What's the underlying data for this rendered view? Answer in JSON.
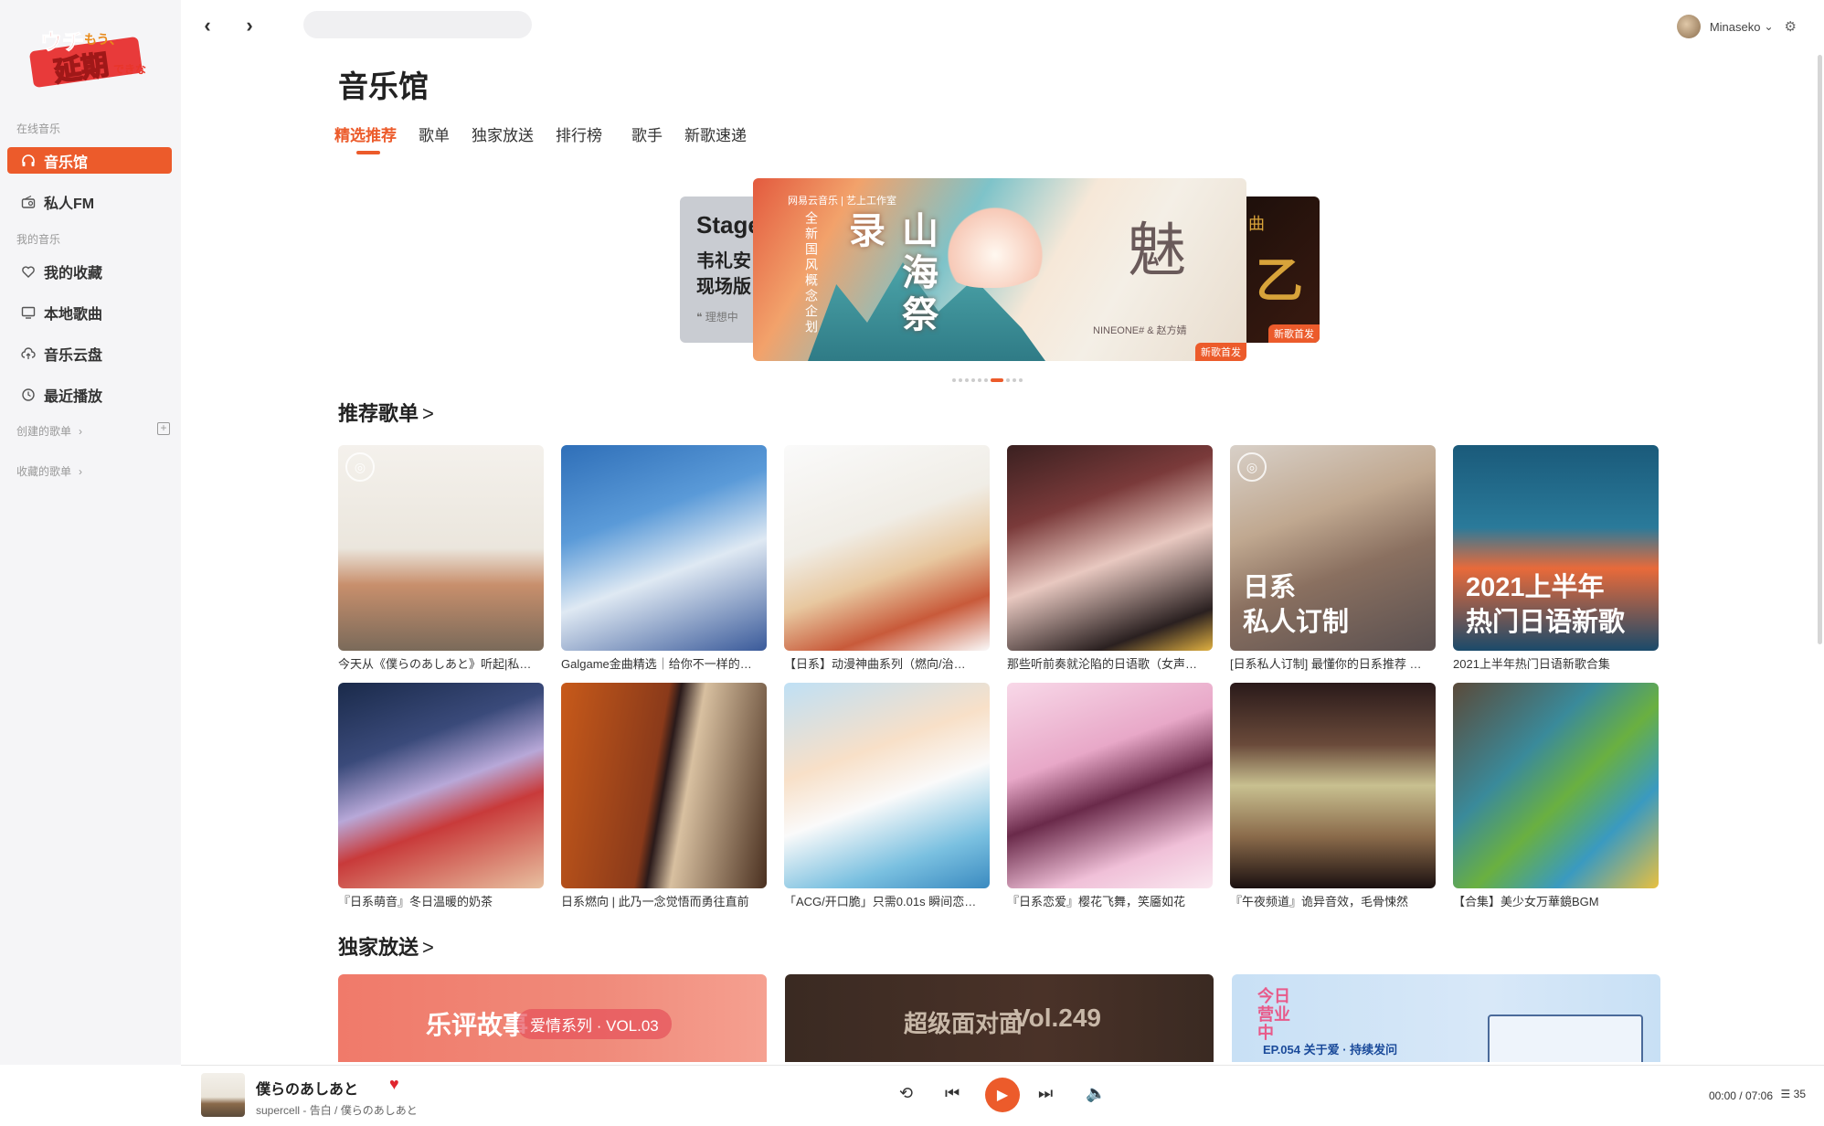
{
  "logo_text": "ウチはもう、延期できない。",
  "sidebar": {
    "online_label": "在线音乐",
    "items_online": [
      {
        "label": "音乐馆",
        "icon": "headphones-icon",
        "glyph": "🎧"
      },
      {
        "label": "私人FM",
        "icon": "radio-icon",
        "glyph": "📻"
      }
    ],
    "my_music_label": "我的音乐",
    "items_mine": [
      {
        "label": "我的收藏",
        "icon": "heart-icon",
        "glyph": "♡"
      },
      {
        "label": "本地歌曲",
        "icon": "monitor-icon",
        "glyph": "🖥"
      },
      {
        "label": "音乐云盘",
        "icon": "cloud-icon",
        "glyph": "☁"
      },
      {
        "label": "最近播放",
        "icon": "clock-icon",
        "glyph": "🕒"
      }
    ],
    "created_label": "创建的歌单",
    "collected_label": "收藏的歌单"
  },
  "topbar": {
    "back": "‹",
    "forward": "›",
    "search_placeholder": "",
    "username": "Minaseko",
    "caret": "⌄",
    "gear": "⚙"
  },
  "page_title": "音乐馆",
  "tabs": [
    "精选推荐",
    "歌单",
    "独家放送",
    "排行榜",
    "歌手",
    "新歌速递"
  ],
  "banner": {
    "left": {
      "title": "Stage",
      "line1": "韦礼安",
      "line2": "现场版",
      "quote": "❝ 理想中"
    },
    "main": {
      "header": "网易云音乐 | 艺上工作室",
      "vertical": "全新国风概念企划",
      "big": "山海祭录",
      "glyph": "魅",
      "credit": "NINEONE# & 赵方婧",
      "badge": "新歌首发"
    },
    "right": {
      "glyph": "曲",
      "glyph2": "乙",
      "badge": "新歌首发"
    },
    "dots_count": 10,
    "active_dot": 7
  },
  "recommend": {
    "title": "推荐歌单",
    "chevron": ">",
    "playlists": [
      {
        "title": "今天从《僕らのあしあと》听起|私…",
        "overlay": "",
        "radio": true,
        "bg": "linear-gradient(180deg,#f4f1ec 0%,#ebe6dd 50%,#c88f6c 68%,#7a6a5a 100%)"
      },
      {
        "title": "Galgame金曲精选｜给你不一样的…",
        "overlay": "",
        "radio": false,
        "bg": "linear-gradient(160deg,#2f6fb8 0%,#5a9ad8 35%,#dfe9f3 60%,#3a5a9a 100%)"
      },
      {
        "title": "【日系】动漫神曲系列（燃向/治…",
        "overlay": "",
        "radio": false,
        "bg": "linear-gradient(160deg,#fafafa 0%,#f0ede6 40%,#e8c8a0 60%,#c85a3a 80%,#fafafa 100%)"
      },
      {
        "title": "那些听前奏就沦陷的日语歌（女声…",
        "overlay": "",
        "radio": false,
        "bg": "linear-gradient(160deg,#3a2020 0%,#7a3a3a 30%,#e8c8c0 55%,#2a2020 85%,#e0b040 100%)"
      },
      {
        "title": "[日系私人订制] 最懂你的日系推荐 …",
        "overlay": "日系\n私人订制",
        "radio": true,
        "bg": "linear-gradient(160deg,#d8d0c8 0%,#c0a890 35%,#8a7060 60%,#5a5050 100%)"
      },
      {
        "title": "2021上半年热门日语新歌合集",
        "overlay": "2021上半年\n热门日语新歌",
        "radio": false,
        "bg": "linear-gradient(180deg,#1a5a7a 0%,#2a7a9a 40%,#e86a3a 60%,#1a4a6a 100%)"
      },
      {
        "title": "『日系萌音』冬日温暖的奶茶",
        "overlay": "",
        "radio": false,
        "bg": "linear-gradient(160deg,#1a2a4a 0%,#3a4a7a 30%,#b8a8d8 50%,#c83a3a 65%,#e8c0a0 100%)"
      },
      {
        "title": "日系燃向 | 此乃一念觉悟而勇往直前",
        "overlay": "",
        "radio": false,
        "bg": "linear-gradient(100deg,#c85a1a 0%,#8a3a1a 45%,#2a1a1a 50%,#d8c0a0 60%,#4a3020 100%)"
      },
      {
        "title": "「ACG/开口脆」只需0.01s 瞬间恋…",
        "overlay": "",
        "radio": false,
        "bg": "linear-gradient(160deg,#bfe0f5 0%,#f8e0c8 35%,#fafafa 55%,#7ac0e0 80%,#3a8ac0 100%)"
      },
      {
        "title": "『日系恋爱』樱花飞舞，笑靥如花",
        "overlay": "",
        "radio": false,
        "bg": "linear-gradient(160deg,#f8d8e8 0%,#e8a8c8 35%,#6a2a4a 55%,#f0c0d8 80%,#fae8f0 100%)"
      },
      {
        "title": "『午夜频道』诡异音效，毛骨悚然",
        "overlay": "",
        "radio": false,
        "bg": "linear-gradient(180deg,#2a1a1a 0%,#6a4a3a 30%,#c8c090 50%,#8a6a4a 75%,#1a1010 100%)"
      },
      {
        "title": "【合集】美少女万華鏡BGM",
        "overlay": "",
        "radio": false,
        "bg": "linear-gradient(135deg,#5a4a3a 0%,#3a8a9a 35%,#6ab040 55%,#3a9ac0 75%,#e8c040 100%)"
      }
    ]
  },
  "exclusive": {
    "title": "独家放送",
    "chevron": ">",
    "items": [
      {
        "text1": "乐评故事",
        "text2": "爱情系列 · VOL.03",
        "bg": "linear-gradient(90deg,#f07a6a,#f08a7a 60%,#f5a090)"
      },
      {
        "text1": "超级面对面",
        "text2": "Vol.249",
        "bg": "linear-gradient(90deg,#3a2a22,#4a3228 60%,#3a2a22)"
      },
      {
        "text1": "今日营业中",
        "text2": "EP.054  关于爱 · 持续发问",
        "bg": "linear-gradient(90deg,#c8e0f5,#d8e8f8 60%,#c8e0f5)"
      }
    ]
  },
  "player": {
    "title": "僕らのあしあと",
    "artist": "supercell - 告白 / 僕らのあしあと",
    "time": "00:00 / 07:06",
    "queue_count": "35",
    "icons": {
      "loop": "⟲",
      "prev": "⏮",
      "play": "▶",
      "next": "⏭",
      "volume": "🔈",
      "heart": "♥",
      "list": "☰"
    }
  },
  "colors": {
    "accent": "#ec5b2b",
    "heart": "#e0252e"
  }
}
